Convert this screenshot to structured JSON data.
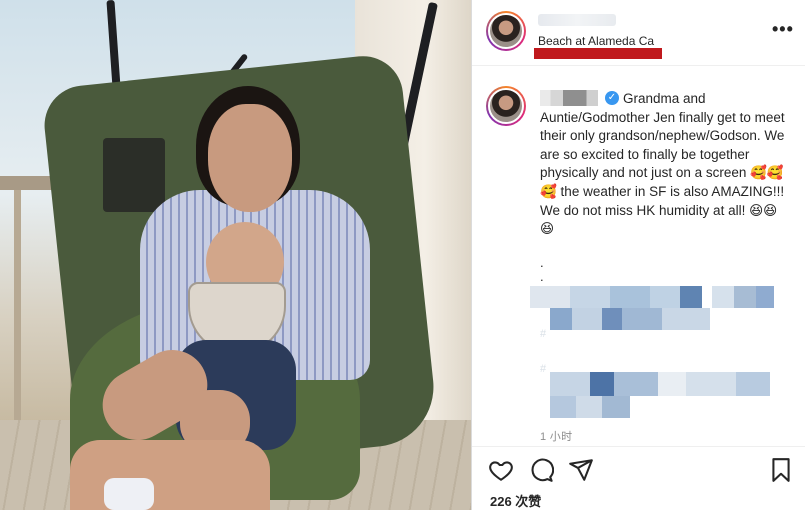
{
  "post": {
    "location": "Beach at Alameda Ca",
    "more_label": "•••",
    "caption": "Grandma and Auntie/Godmother Jen finally get to meet their only grandson/nephew/Godson. We are so excited to finally be together physically and not just on a screen 🥰🥰🥰 the weather in SF is also AMAZING!!! We do not miss HK humidity at all! 😆😆😆",
    "dot1": ".",
    "dot2": ".",
    "hashtag_fragment_1": "#",
    "hashtag_fragment_2": "#",
    "time": "1 小时",
    "likes": "226 次赞"
  },
  "icons": {
    "verified": "verified-badge-icon",
    "like": "heart-icon",
    "comment": "comment-icon",
    "share": "paper-plane-icon",
    "save": "bookmark-icon",
    "more": "more-options-icon"
  },
  "colors": {
    "verified_blue": "#3897f0",
    "redaction_red": "#c0191d",
    "story_ring": "#dd2a7b"
  }
}
